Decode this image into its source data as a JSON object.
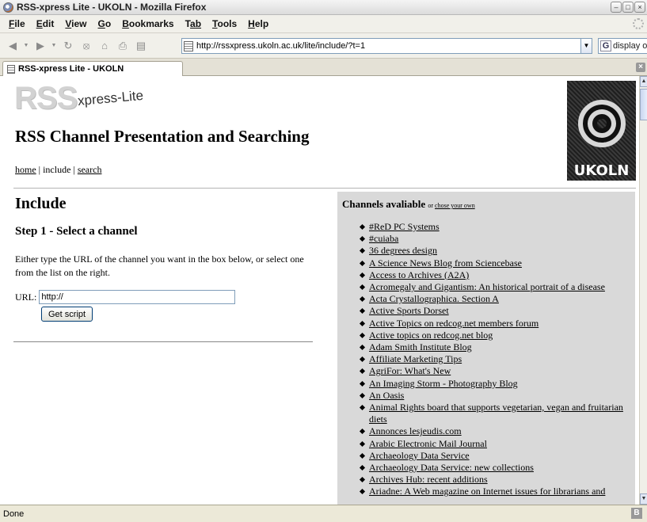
{
  "window": {
    "title": "RSS-xpress Lite - UKOLN - Mozilla Firefox",
    "controls": [
      "minimize",
      "maximize",
      "close"
    ]
  },
  "menu": {
    "items": [
      {
        "ul": "F",
        "rest": "ile"
      },
      {
        "ul": "E",
        "rest": "dit"
      },
      {
        "ul": "V",
        "rest": "iew"
      },
      {
        "ul": "G",
        "rest": "o"
      },
      {
        "ul": "B",
        "rest": "ookmarks"
      },
      {
        "ul": "T",
        "rest": "ab"
      },
      {
        "ul": "T",
        "rest": "ools"
      },
      {
        "ul": "H",
        "rest": "elp"
      }
    ]
  },
  "toolbar": {
    "buttons": [
      "back-icon",
      "forward-icon",
      "reload-icon",
      "stop-icon",
      "home-icon",
      "print-icon",
      "new-tab-icon"
    ],
    "url": "http://rssxpress.ukoln.ac.uk/lite/include/?t=1",
    "search_placeholder": "display our news your"
  },
  "tab": {
    "title": "RSS-xpress Lite - UKOLN"
  },
  "page": {
    "logo_main": "RSS",
    "logo_sub": "xpress-Lite",
    "site_title": "RSS Channel Presentation and Searching",
    "nav": {
      "home": "home",
      "sep1": " | ",
      "include": "include",
      "sep2": " | ",
      "search": "search"
    },
    "ukoln_logo_text": "UKOLN",
    "heading": "Include",
    "step_title": "Step 1 - Select a channel",
    "instructions": "Either type the URL of the channel you want in the box below, or select one from the list on the right.",
    "url_label": "URL:",
    "url_value": "http://",
    "submit_label": "Get script"
  },
  "channels": {
    "heading": "Channels avaliable",
    "or_text": "or",
    "choose_link": "chose your own",
    "items": [
      "#ReD PC Systems",
      "#cuiaba",
      "36 degrees design",
      "A Science News Blog from Sciencebase",
      "Access to Archives (A2A)",
      "Acromegaly and Gigantism: An historical portrait of a disease",
      "Acta Crystallographica. Section A",
      "Active Sports Dorset",
      "Active Topics on redcog.net members forum",
      "Active topics on redcog.net blog",
      "Adam Smith Institute Blog",
      "Affiliate Marketing Tips",
      "AgriFor: What's New",
      "An Imaging Storm - Photography Blog",
      "An Oasis",
      "Animal Rights board that supports vegetarian, vegan and fruitarian diets",
      "Annonces lesjeudis.com",
      "Arabic Electronic Mail Journal",
      "Archaeology Data Service",
      "Archaeology Data Service: new collections",
      "Archives Hub: recent additions",
      "Ariadne: A Web magazine on Internet issues for librarians and"
    ]
  },
  "status": {
    "text": "Done"
  }
}
